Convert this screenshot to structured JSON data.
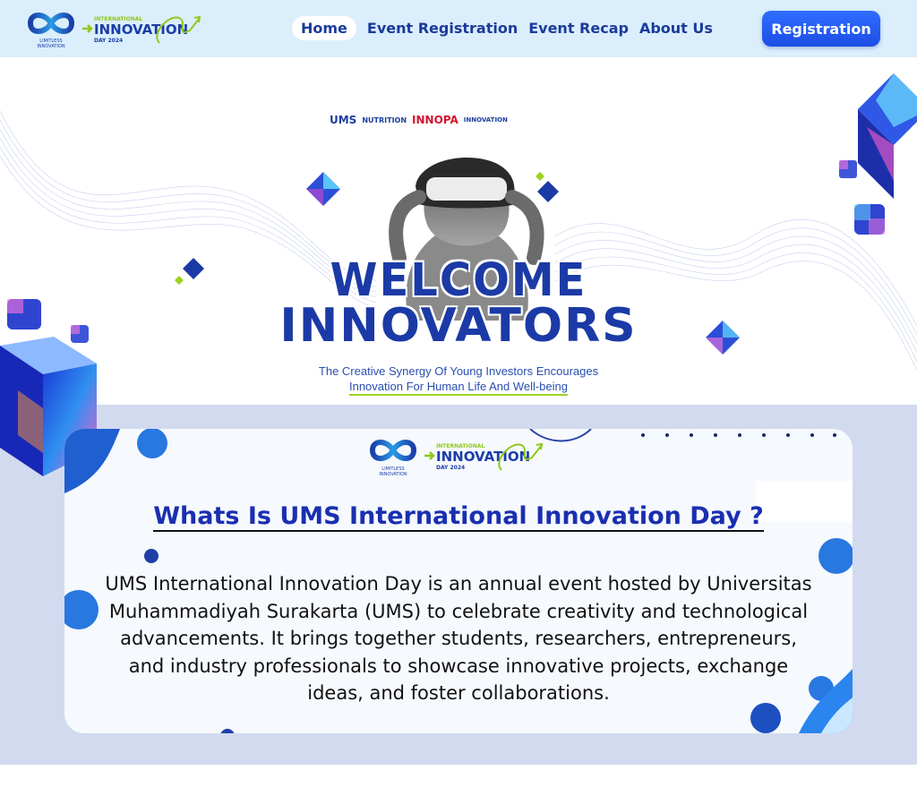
{
  "navbar": {
    "logo": {
      "limitless_line1": "LIMITLESS",
      "limitless_line2": "INNOVATION",
      "event_small": "INTERNATIONAL",
      "event_big": "INNOVATION",
      "event_year": "DAY 2024"
    },
    "links": [
      {
        "label": "Home",
        "active": true
      },
      {
        "label": "Event Registration",
        "active": false
      },
      {
        "label": "Event Recap",
        "active": false
      },
      {
        "label": "About Us",
        "active": false
      }
    ],
    "cta_label": "Registration"
  },
  "hero": {
    "partners": [
      "UMS",
      "NUTRITION",
      "INNOPA",
      "INNOVATION"
    ],
    "headline_1": "WELCOME",
    "headline_2": "INNOVATORS",
    "tagline_line1": "The Creative Synergy Of Young Investors Encourages",
    "tagline_line2": "Innovation For Human Life And Well-being"
  },
  "about": {
    "logo": {
      "limitless_line1": "LIMITLESS",
      "limitless_line2": "INNOVATION",
      "event_small": "INTERNATIONAL",
      "event_big": "INNOVATION",
      "event_year": "DAY 2024"
    },
    "title": "Whats Is UMS International Innovation Day ?",
    "body": "UMS International Innovation Day is an annual event hosted by Universitas Muhammadiyah Surakarta (UMS) to celebrate creativity and technological advancements. It brings together students, researchers, entrepreneurs, and industry professionals to showcase innovative projects, exchange ideas, and foster collaborations."
  },
  "colors": {
    "nav_bg": "#dbeefb",
    "brand_blue": "#1b3aa6",
    "cta_blue": "#2f6dff",
    "accent_green": "#9ed21c",
    "section_bg": "#d2daef",
    "card_bg": "#f6f9fd"
  }
}
